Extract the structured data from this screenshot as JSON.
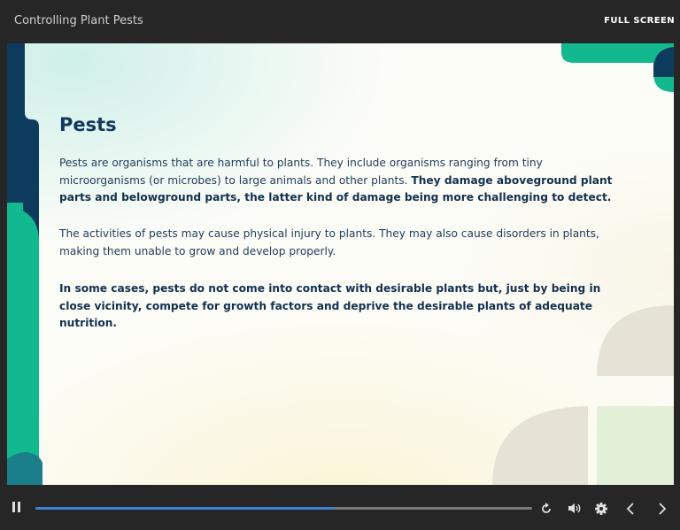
{
  "header": {
    "title": "Controlling Plant Pests",
    "fullscreen_label": "FULL SCREEN"
  },
  "slide": {
    "heading": "Pests",
    "paragraph1_normal": "Pests are organisms that are harmful to plants. They include organisms ranging from tiny microorganisms (or microbes) to large animals and other plants.",
    "paragraph1_bold": "They damage aboveground plant parts and belowground parts, the latter kind of damage being more challenging to detect.",
    "paragraph2": "The activities of pests may cause physical injury to plants. They may also cause disorders in plants, making them unable to grow and develop properly.",
    "paragraph3": "In some cases, pests do not come into contact with desirable plants but, just by being in close vicinity, compete for growth factors and deprive the desirable plants of adequate nutrition."
  },
  "player": {
    "progress_fraction": 0.6,
    "icons": [
      "pause-icon",
      "replay-icon",
      "volume-icon",
      "settings-icon",
      "chevron-left-icon",
      "chevron-right-icon"
    ]
  },
  "colors": {
    "navy": "#0d3b5e",
    "teal": "#12b98f",
    "accent_blue": "#3d82d3",
    "beige": "#e6e3d6",
    "light_green": "#e3f0d8"
  }
}
